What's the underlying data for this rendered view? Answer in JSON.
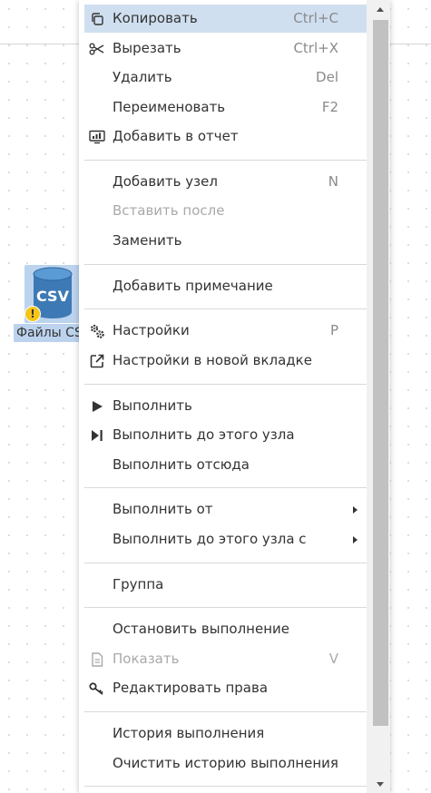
{
  "node": {
    "icon_text": "CSV",
    "label": "Файлы CSV",
    "warning_symbol": "!"
  },
  "menu": {
    "items": [
      {
        "label": "Копировать",
        "shortcut": "Ctrl+C",
        "icon": "copy-icon"
      },
      {
        "label": "Вырезать",
        "shortcut": "Ctrl+X",
        "icon": "scissors-icon"
      },
      {
        "label": "Удалить",
        "shortcut": "Del"
      },
      {
        "label": "Переименовать",
        "shortcut": "F2"
      },
      {
        "label": "Добавить в отчет",
        "icon": "report-icon"
      },
      {
        "label": "Добавить узел",
        "shortcut": "N"
      },
      {
        "label": "Вставить после"
      },
      {
        "label": "Заменить"
      },
      {
        "label": "Добавить примечание"
      },
      {
        "label": "Настройки",
        "shortcut": "P",
        "icon": "gears-icon"
      },
      {
        "label": "Настройки в новой вкладке",
        "icon": "external-link-icon"
      },
      {
        "label": "Выполнить",
        "icon": "play-icon"
      },
      {
        "label": "Выполнить до этого узла",
        "icon": "play-to-icon"
      },
      {
        "label": "Выполнить отсюда"
      },
      {
        "label": "Выполнить от"
      },
      {
        "label": "Выполнить до этого узла с"
      },
      {
        "label": "Группа"
      },
      {
        "label": "Остановить выполнение"
      },
      {
        "label": "Показать",
        "shortcut": "V",
        "icon": "document-icon"
      },
      {
        "label": "Редактировать права",
        "icon": "key-icon"
      },
      {
        "label": "История выполнения"
      },
      {
        "label": "Очистить историю выполнения"
      }
    ]
  },
  "colors": {
    "highlight": "#cfdff0",
    "node_selection": "#bcd3ee",
    "csv_icon": "#3d7ab5",
    "warning": "#f5c518",
    "disabled_text": "#a9a9a9"
  }
}
